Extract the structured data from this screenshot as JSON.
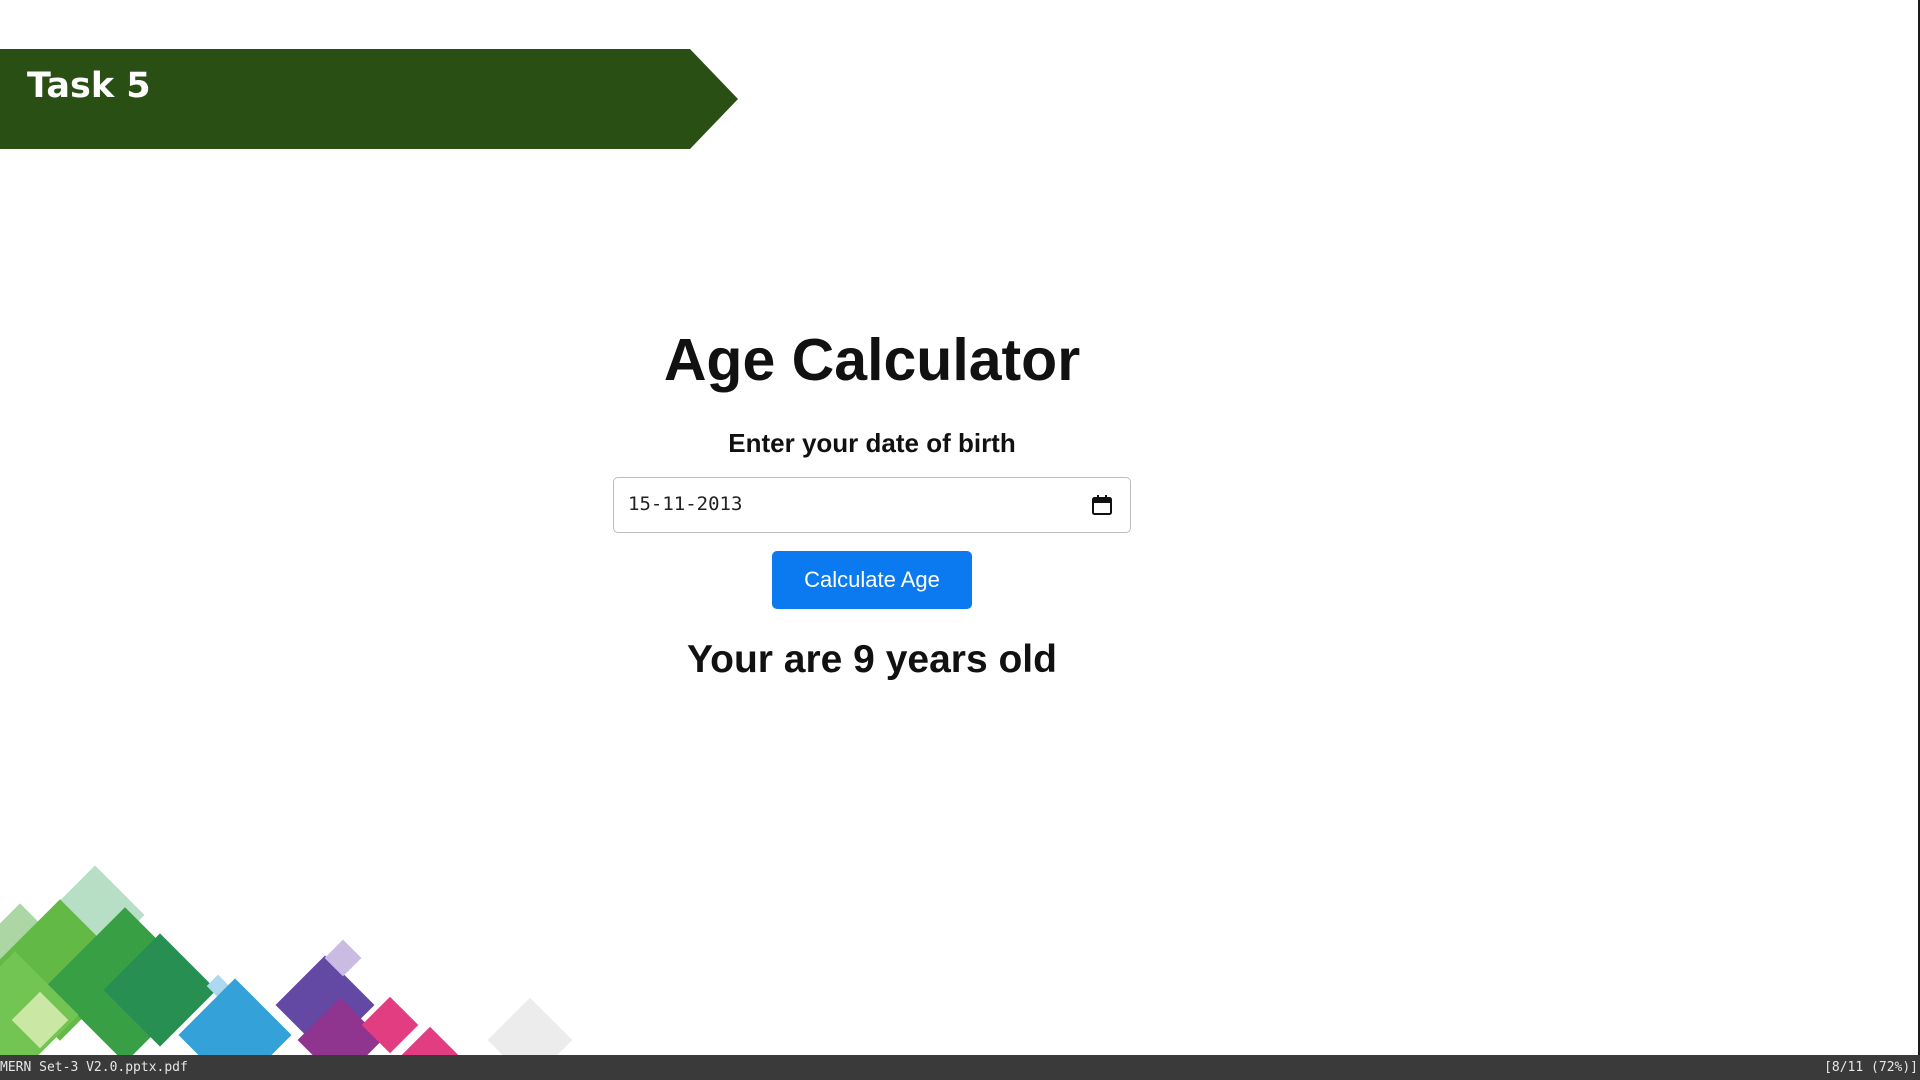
{
  "slide": {
    "task_title": "Task 5",
    "banner_color": "#2a4f14"
  },
  "app": {
    "title": "Age Calculator",
    "dob_label": "Enter your date of birth",
    "date_value": "15-11-2013",
    "button_label": "Calculate Age",
    "button_color": "#0b7af0",
    "result": "Your are 9 years old",
    "calendar_icon": "calendar-icon"
  },
  "status_bar": {
    "file_name": "MERN Set-3 V2.0.pptx.pdf",
    "page_info": "[8/11 (72%)]"
  }
}
